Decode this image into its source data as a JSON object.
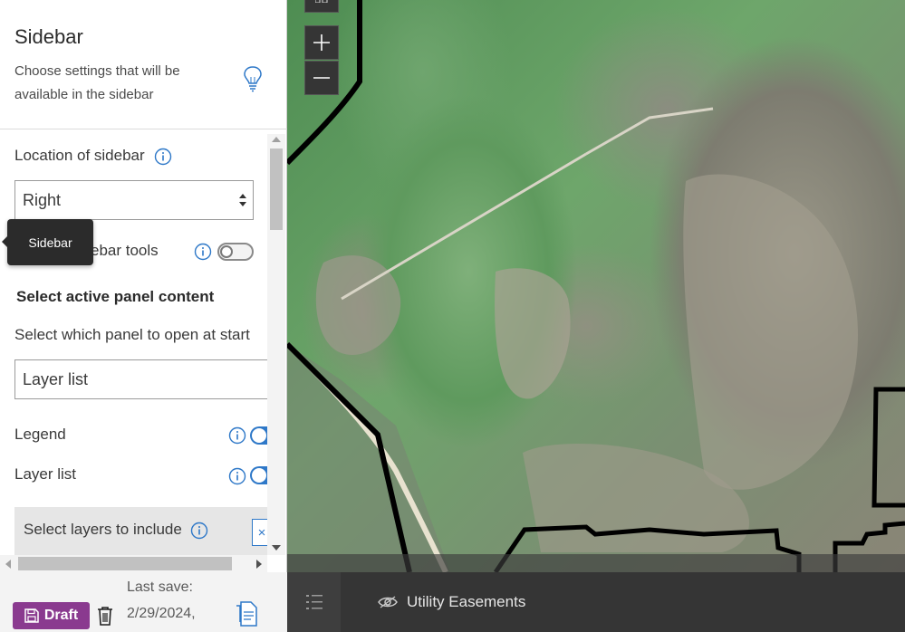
{
  "sidebar": {
    "title": "Sidebar",
    "description": "Choose settings that will be available in the sidebar",
    "location_label": "Location of sidebar",
    "location_value": "Right",
    "tools_label": "ebar tools",
    "tools_toggle_on": false,
    "section_heading": "Select active panel content",
    "panel_select_label": "Select which panel to open at start",
    "panel_select_value": "Layer list",
    "legend_label": "Legend",
    "legend_toggle_on": true,
    "layer_list_label": "Layer list",
    "layer_list_toggle_on": true,
    "select_layers_label": "Select layers to include",
    "tooltip": "Sidebar"
  },
  "footer": {
    "draft_label": "Draft",
    "last_save_label": "Last save:",
    "last_save_date": "2/29/2024,"
  },
  "map": {
    "layer_name": "Utility Easements"
  },
  "colors": {
    "accent_blue": "#2e78c8",
    "draft_purple": "#8a3a8f",
    "map_toolbar": "#353535"
  }
}
